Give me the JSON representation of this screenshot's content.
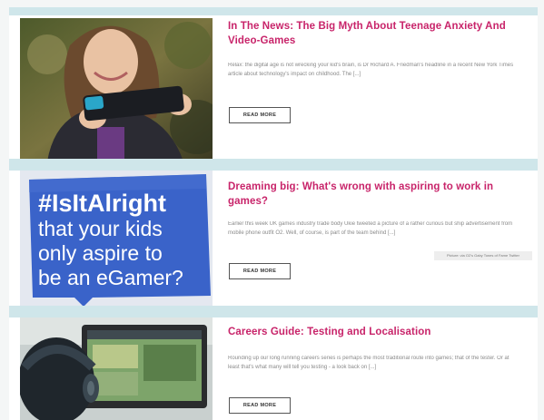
{
  "articles": [
    {
      "title": "In The News: The Big Myth About Teenage Anxiety And Video-Games",
      "excerpt": "Relax: the digital age is not wrecking your kid's brain, is Dr Richard A. Friedman's headline in a recent New York Times article about technology's impact on childhood. The [...]",
      "button": "READ MORE",
      "image": "girl-playing-handheld-console"
    },
    {
      "title": "Dreaming big: What's wrong with aspiring to work in games?",
      "excerpt": "Earlier this week UK games industry trade body Ukie tweeted a picture of a rather curious but ship advertisement from mobile phone outfit O2. Well, of course, is part of the team behind [...]",
      "button": "READ MORE",
      "image_caption": "Picture: via O2's Gaby Tones of Fame Twitter",
      "image": "hashtag-sign",
      "sign_lines": [
        "#IsItAlright",
        "that your kids",
        "only aspire to",
        "be an eGamer?"
      ]
    },
    {
      "title": "Careers Guide: Testing and Localisation",
      "excerpt": "Rounding up our long running careers series is perhaps the most traditional route into games; that of the tester. Or at least that's what many will tell you testing - a look back on [...]",
      "button": "READ MORE",
      "image": "person-with-headphones-at-monitor"
    }
  ],
  "colors": {
    "title": "#c8246a",
    "band": "#cfe6ea",
    "sign_bg": "#3a63c9"
  }
}
